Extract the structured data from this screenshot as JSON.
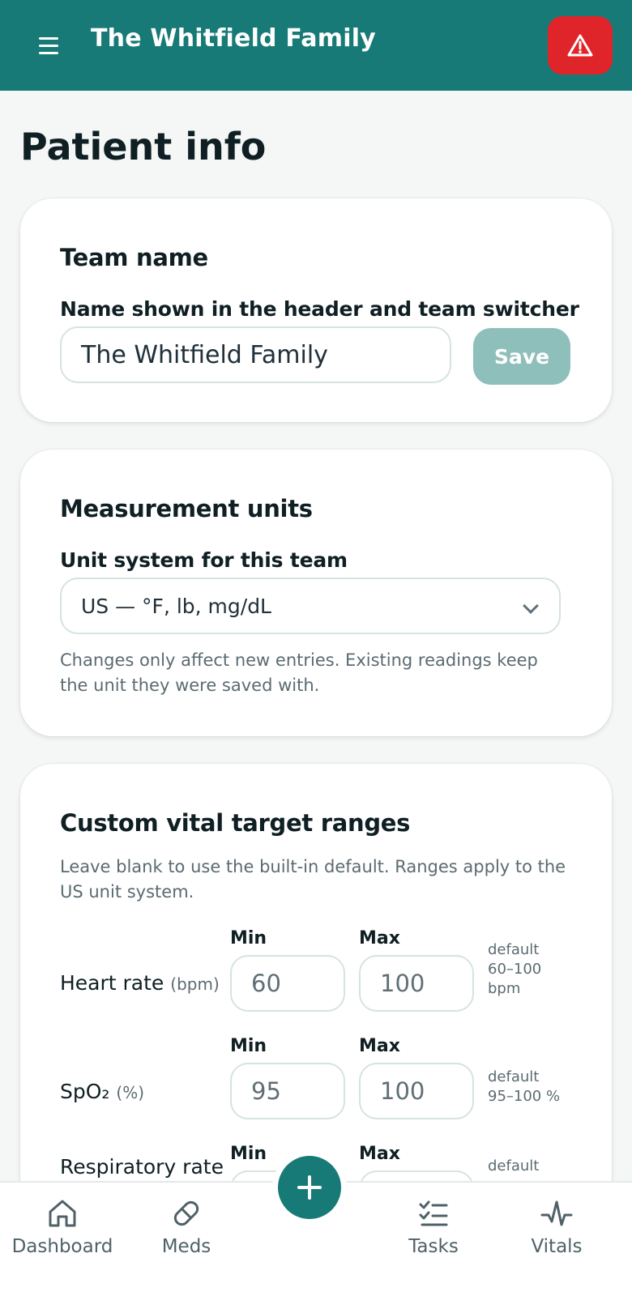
{
  "header": {
    "team_name": "The Whitfield Family",
    "menu_icon": "hamburger-menu-icon",
    "alert_icon": "warning-triangle-icon"
  },
  "page": {
    "title": "Patient info"
  },
  "team_card": {
    "title": "Team name",
    "label": "Name shown in the header and team switcher",
    "value": "The Whitfield Family",
    "save_label": "Save"
  },
  "units_card": {
    "title": "Measurement units",
    "label": "Unit system for this team",
    "selected": "US — °F, lb, mg/dL",
    "help": "Changes only affect new entries. Existing readings keep the unit they were saved with."
  },
  "vitals_card": {
    "title": "Custom vital target ranges",
    "help": "Leave blank to use the built-in default. Ranges apply to the US unit system.",
    "min_label": "Min",
    "max_label": "Max",
    "rows": [
      {
        "name": "Heart rate",
        "unit": "(bpm)",
        "min": "60",
        "max": "100",
        "default_line1": "default",
        "default_line2": "60–100",
        "default_line3": "bpm"
      },
      {
        "name": "SpO₂",
        "unit": "(%)",
        "min": "95",
        "max": "100",
        "default_line1": "default",
        "default_line2": "95–100 %",
        "default_line3": ""
      },
      {
        "name": "Respiratory rate",
        "unit": "",
        "min": "",
        "max": "",
        "default_line1": "default",
        "default_line2": "",
        "default_line3": ""
      }
    ]
  },
  "nav": {
    "items": [
      {
        "label": "Dashboard",
        "icon": "home-icon"
      },
      {
        "label": "Meds",
        "icon": "pill-icon"
      },
      {
        "label": "Tasks",
        "icon": "checklist-icon"
      },
      {
        "label": "Vitals",
        "icon": "pulse-icon"
      }
    ],
    "fab_icon": "plus-icon"
  },
  "colors": {
    "brand": "#177a76",
    "alert": "#e0252a",
    "save_disabled": "#8fbfba"
  }
}
